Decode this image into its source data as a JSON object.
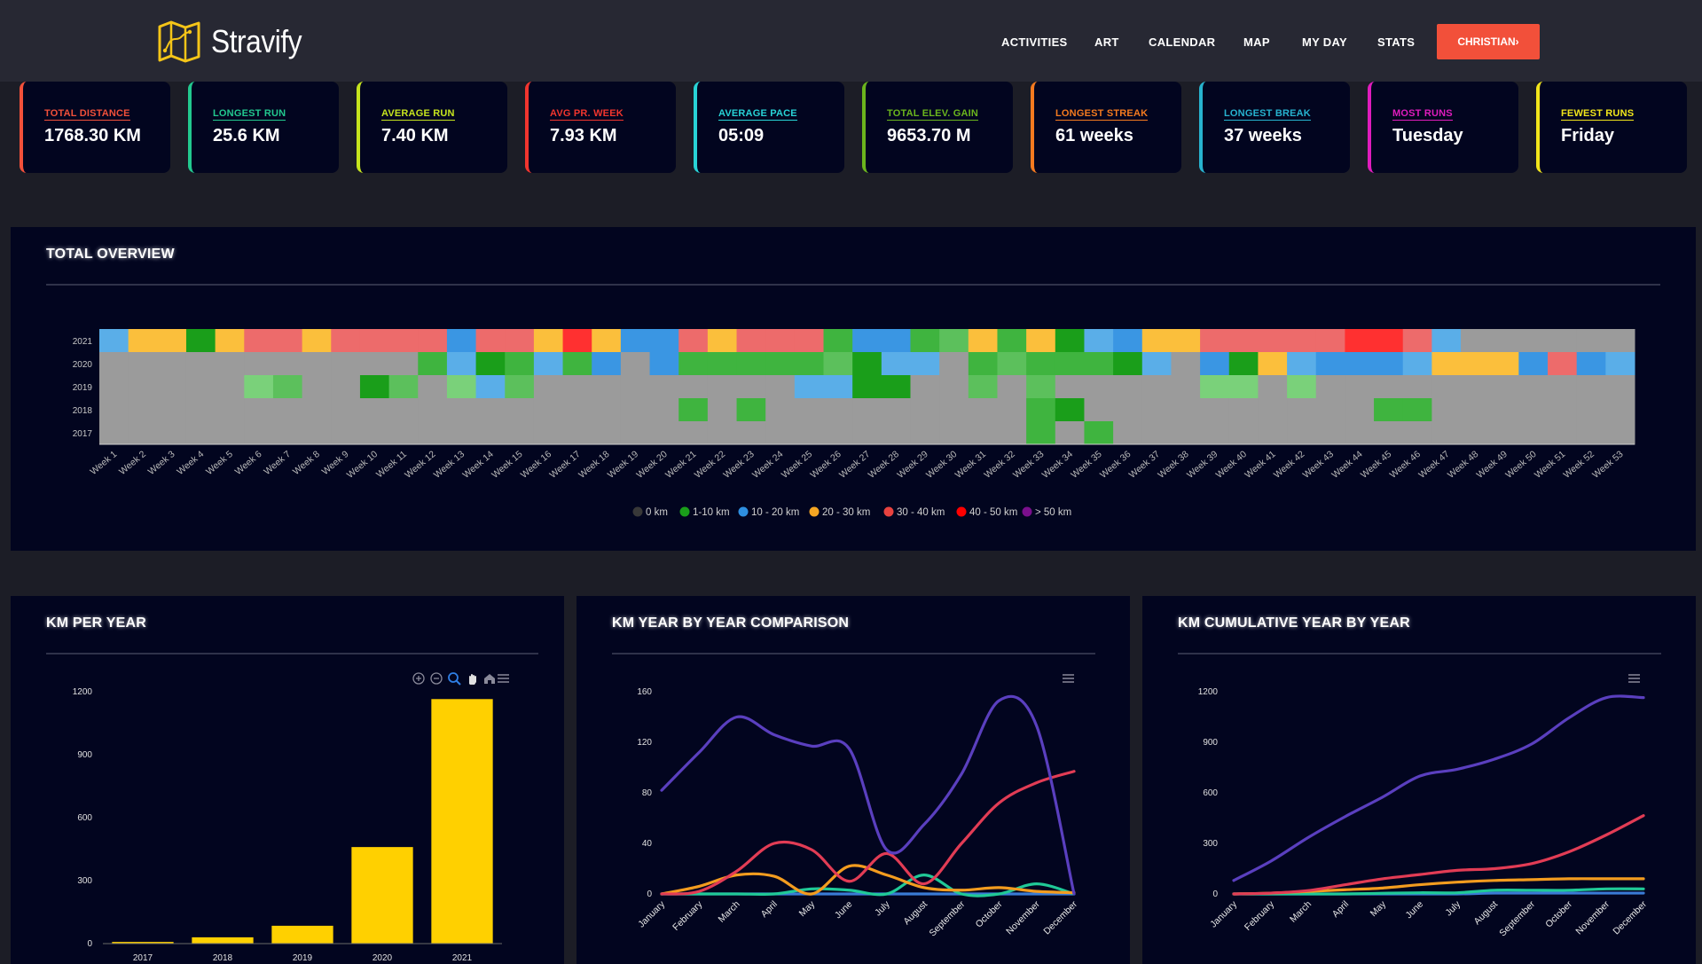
{
  "app": {
    "name": "Stravify"
  },
  "nav": {
    "items": [
      "ACTIVITIES",
      "ART",
      "CALENDAR",
      "MAP",
      "MY DAY",
      "STATS"
    ],
    "user_button": "CHRISTIAN›"
  },
  "stats": [
    {
      "label": "TOTAL DISTANCE",
      "value": "1768.30 KM",
      "color": "#f2503a"
    },
    {
      "label": "LONGEST RUN",
      "value": "25.6 KM",
      "color": "#22c98f"
    },
    {
      "label": "AVERAGE RUN",
      "value": "7.40 KM",
      "color": "#c6e41e"
    },
    {
      "label": "AVG PR. WEEK",
      "value": "7.93 KM",
      "color": "#f2352e"
    },
    {
      "label": "AVERAGE PACE",
      "value": "05:09",
      "color": "#28d3d6"
    },
    {
      "label": "TOTAL ELEV. GAIN",
      "value": "9653.70 M",
      "color": "#6bb51d"
    },
    {
      "label": "LONGEST STREAK",
      "value": "61 weeks",
      "color": "#f57a1f"
    },
    {
      "label": "LONGEST BREAK",
      "value": "37 weeks",
      "color": "#27b3cf"
    },
    {
      "label": "MOST RUNS",
      "value": "Tuesday",
      "color": "#e01cbd"
    },
    {
      "label": "FEWEST RUNS",
      "value": "Friday",
      "color": "#f2e51b"
    }
  ],
  "overview": {
    "title": "TOTAL OVERVIEW"
  },
  "kmYear": {
    "title": "KM PER YEAR"
  },
  "comparison": {
    "title": "KM YEAR BY YEAR COMPARISON"
  },
  "cumulative": {
    "title": "KM CUMULATIVE YEAR BY YEAR"
  },
  "chart_data": [
    {
      "type": "heatmap",
      "rows": [
        "2021",
        "2020",
        "2019",
        "2018",
        "2017"
      ],
      "columns": [
        "Week 1",
        "Week 2",
        "Week 3",
        "Week 4",
        "Week 5",
        "Week 6",
        "Week 7",
        "Week 8",
        "Week 9",
        "Week 10",
        "Week 11",
        "Week 12",
        "Week 13",
        "Week 14",
        "Week 15",
        "Week 16",
        "Week 17",
        "Week 18",
        "Week 19",
        "Week 20",
        "Week 21",
        "Week 22",
        "Week 23",
        "Week 24",
        "Week 25",
        "Week 26",
        "Week 27",
        "Week 28",
        "Week 29",
        "Week 30",
        "Week 31",
        "Week 32",
        "Week 33",
        "Week 34",
        "Week 35",
        "Week 36",
        "Week 37",
        "Week 38",
        "Week 39",
        "Week 40",
        "Week 41",
        "Week 42",
        "Week 43",
        "Week 44",
        "Week 45",
        "Week 46",
        "Week 47",
        "Week 48",
        "Week 49",
        "Week 50",
        "Week 51",
        "Week 52",
        "Week 53"
      ],
      "legend": [
        {
          "label": "0 km",
          "color": "#383838"
        },
        {
          "label": "1-10 km",
          "color": "#1a9e1a"
        },
        {
          "label": "10 - 20 km",
          "color": "#2e8fe0"
        },
        {
          "label": "20 - 30 km",
          "color": "#f5a623"
        },
        {
          "label": "30 - 40 km",
          "color": "#e8423f"
        },
        {
          "label": "40 - 50 km",
          "color": "#ff0000"
        },
        {
          "label": "> 50 km",
          "color": "#7a0f8c"
        }
      ],
      "cell_colors": [
        [
          "#5aaee8",
          "#fbbf3c",
          "#fbbf3c",
          "#1a9e1a",
          "#fbbf3c",
          "#ed6b6b",
          "#ed6b6b",
          "#fbbf3c",
          "#ed6b6b",
          "#ed6b6b",
          "#ed6b6b",
          "#ed6b6b",
          "#3a96e3",
          "#ed6b6b",
          "#ed6b6b",
          "#fbbf3c",
          "#ff3030",
          "#fbbf3c",
          "#3a96e3",
          "#3a96e3",
          "#ed6b6b",
          "#fbbf3c",
          "#ed6b6b",
          "#ed6b6b",
          "#ed6b6b",
          "#3fb43f",
          "#3a96e3",
          "#3a96e3",
          "#3fb43f",
          "#5cc05c",
          "#fbbf3c",
          "#3fb43f",
          "#fbbf3c",
          "#1a9e1a",
          "#5aaee8",
          "#3a96e3",
          "#fbbf3c",
          "#fbbf3c",
          "#ed6b6b",
          "#ed6b6b",
          "#ed6b6b",
          "#ed6b6b",
          "#ed6b6b",
          "#ff3030",
          "#ff3030",
          "#ed6b6b",
          "#5aaee8",
          "#9b9b9b",
          "#9b9b9b",
          "#9b9b9b",
          "#9b9b9b",
          "#9b9b9b",
          "#9b9b9b"
        ],
        [
          "#9b9b9b",
          "#9b9b9b",
          "#9b9b9b",
          "#9b9b9b",
          "#9b9b9b",
          "#9b9b9b",
          "#9b9b9b",
          "#9b9b9b",
          "#9b9b9b",
          "#9b9b9b",
          "#9b9b9b",
          "#3fb43f",
          "#5aaee8",
          "#1a9e1a",
          "#3fb43f",
          "#5aaee8",
          "#3fb43f",
          "#3a96e3",
          "#9b9b9b",
          "#3a96e3",
          "#3fb43f",
          "#3fb43f",
          "#3fb43f",
          "#3fb43f",
          "#3fb43f",
          "#5cc05c",
          "#1a9e1a",
          "#5aaee8",
          "#5aaee8",
          "#9b9b9b",
          "#3fb43f",
          "#5cc05c",
          "#3fb43f",
          "#3fb43f",
          "#3fb43f",
          "#1a9e1a",
          "#5aaee8",
          "#9b9b9b",
          "#3a96e3",
          "#1a9e1a",
          "#fbbf3c",
          "#5aaee8",
          "#3a96e3",
          "#3a96e3",
          "#3a96e3",
          "#5aaee8",
          "#fbbf3c",
          "#fbbf3c",
          "#fbbf3c",
          "#3a96e3",
          "#ed6b6b",
          "#3a96e3",
          "#5aaee8"
        ],
        [
          "#9b9b9b",
          "#9b9b9b",
          "#9b9b9b",
          "#9b9b9b",
          "#9b9b9b",
          "#7ad17a",
          "#5cc05c",
          "#9b9b9b",
          "#9b9b9b",
          "#1a9e1a",
          "#5cc05c",
          "#9b9b9b",
          "#7ad17a",
          "#5aaee8",
          "#5cc05c",
          "#9b9b9b",
          "#9b9b9b",
          "#9b9b9b",
          "#9b9b9b",
          "#9b9b9b",
          "#9b9b9b",
          "#9b9b9b",
          "#9b9b9b",
          "#9b9b9b",
          "#5aaee8",
          "#5aaee8",
          "#1a9e1a",
          "#1a9e1a",
          "#9b9b9b",
          "#9b9b9b",
          "#5cc05c",
          "#9b9b9b",
          "#5cc05c",
          "#9b9b9b",
          "#9b9b9b",
          "#9b9b9b",
          "#9b9b9b",
          "#9b9b9b",
          "#7ad17a",
          "#7ad17a",
          "#9b9b9b",
          "#7ad17a",
          "#9b9b9b",
          "#9b9b9b",
          "#9b9b9b",
          "#9b9b9b",
          "#9b9b9b",
          "#9b9b9b",
          "#9b9b9b",
          "#9b9b9b",
          "#9b9b9b",
          "#9b9b9b",
          "#9b9b9b"
        ],
        [
          "#9b9b9b",
          "#9b9b9b",
          "#9b9b9b",
          "#9b9b9b",
          "#9b9b9b",
          "#9b9b9b",
          "#9b9b9b",
          "#9b9b9b",
          "#9b9b9b",
          "#9b9b9b",
          "#9b9b9b",
          "#9b9b9b",
          "#9b9b9b",
          "#9b9b9b",
          "#9b9b9b",
          "#9b9b9b",
          "#9b9b9b",
          "#9b9b9b",
          "#9b9b9b",
          "#9b9b9b",
          "#3fb43f",
          "#9b9b9b",
          "#3fb43f",
          "#9b9b9b",
          "#9b9b9b",
          "#9b9b9b",
          "#9b9b9b",
          "#9b9b9b",
          "#9b9b9b",
          "#9b9b9b",
          "#9b9b9b",
          "#9b9b9b",
          "#3fb43f",
          "#1a9e1a",
          "#9b9b9b",
          "#9b9b9b",
          "#9b9b9b",
          "#9b9b9b",
          "#9b9b9b",
          "#9b9b9b",
          "#9b9b9b",
          "#9b9b9b",
          "#9b9b9b",
          "#9b9b9b",
          "#3fb43f",
          "#3fb43f",
          "#9b9b9b",
          "#9b9b9b",
          "#9b9b9b",
          "#9b9b9b",
          "#9b9b9b",
          "#9b9b9b",
          "#9b9b9b"
        ],
        [
          "#9b9b9b",
          "#9b9b9b",
          "#9b9b9b",
          "#9b9b9b",
          "#9b9b9b",
          "#9b9b9b",
          "#9b9b9b",
          "#9b9b9b",
          "#9b9b9b",
          "#9b9b9b",
          "#9b9b9b",
          "#9b9b9b",
          "#9b9b9b",
          "#9b9b9b",
          "#9b9b9b",
          "#9b9b9b",
          "#9b9b9b",
          "#9b9b9b",
          "#9b9b9b",
          "#9b9b9b",
          "#9b9b9b",
          "#9b9b9b",
          "#9b9b9b",
          "#9b9b9b",
          "#9b9b9b",
          "#9b9b9b",
          "#9b9b9b",
          "#9b9b9b",
          "#9b9b9b",
          "#9b9b9b",
          "#9b9b9b",
          "#9b9b9b",
          "#3fb43f",
          "#9b9b9b",
          "#3fb43f",
          "#9b9b9b",
          "#9b9b9b",
          "#9b9b9b",
          "#9b9b9b",
          "#9b9b9b",
          "#9b9b9b",
          "#9b9b9b",
          "#9b9b9b",
          "#9b9b9b",
          "#9b9b9b",
          "#9b9b9b",
          "#9b9b9b",
          "#9b9b9b",
          "#9b9b9b",
          "#9b9b9b",
          "#9b9b9b",
          "#9b9b9b",
          "#9b9b9b"
        ]
      ]
    },
    {
      "type": "bar",
      "title": "KM PER YEAR",
      "categories": [
        "2017",
        "2018",
        "2019",
        "2020",
        "2021"
      ],
      "values": [
        8,
        30,
        85,
        460,
        1165
      ],
      "ylim": [
        0,
        1200
      ],
      "yticks": [
        0,
        300,
        600,
        900,
        1200
      ],
      "color": "#ffd000"
    },
    {
      "type": "line",
      "title": "KM YEAR BY YEAR COMPARISON",
      "categories": [
        "January",
        "February",
        "March",
        "April",
        "May",
        "June",
        "July",
        "August",
        "September",
        "October",
        "November",
        "December"
      ],
      "ylim": [
        0,
        160
      ],
      "yticks": [
        0,
        40,
        80,
        120,
        160
      ],
      "series": [
        {
          "color": "#5a3fbf",
          "values": [
            82,
            112,
            140,
            126,
            117,
            115,
            35,
            55,
            95,
            153,
            133,
            0
          ]
        },
        {
          "color": "#e23c55",
          "values": [
            0,
            2,
            18,
            40,
            35,
            10,
            32,
            8,
            40,
            72,
            88,
            97
          ]
        },
        {
          "color": "#f39c1f",
          "values": [
            0,
            6,
            15,
            14,
            0,
            22,
            15,
            5,
            3,
            5,
            2,
            1
          ]
        },
        {
          "color": "#20c997",
          "values": [
            0,
            0,
            0,
            0,
            4,
            3,
            0,
            15,
            0,
            0,
            8,
            0
          ]
        },
        {
          "color": "#3a7bd5",
          "values": [
            0,
            0,
            0,
            0,
            0,
            0,
            0,
            0,
            0,
            0,
            0,
            0
          ]
        }
      ]
    },
    {
      "type": "line",
      "title": "KM CUMULATIVE YEAR BY YEAR",
      "categories": [
        "January",
        "February",
        "March",
        "April",
        "May",
        "June",
        "July",
        "August",
        "September",
        "October",
        "November",
        "December"
      ],
      "ylim": [
        0,
        1200
      ],
      "yticks": [
        0,
        300,
        600,
        900,
        1200
      ],
      "series": [
        {
          "color": "#5a3fbf",
          "values": [
            80,
            195,
            335,
            460,
            575,
            700,
            740,
            800,
            890,
            1045,
            1165,
            1165
          ]
        },
        {
          "color": "#e23c55",
          "values": [
            0,
            5,
            20,
            55,
            90,
            115,
            140,
            150,
            180,
            250,
            350,
            465
          ]
        },
        {
          "color": "#f39c1f",
          "values": [
            0,
            5,
            15,
            25,
            35,
            55,
            70,
            80,
            85,
            90,
            90,
            90
          ]
        },
        {
          "color": "#20c997",
          "values": [
            0,
            0,
            0,
            0,
            4,
            7,
            7,
            22,
            22,
            22,
            30,
            30
          ]
        },
        {
          "color": "#3a7bd5",
          "values": [
            0,
            0,
            0,
            0,
            0,
            0,
            0,
            5,
            5,
            5,
            5,
            5
          ]
        }
      ]
    }
  ]
}
